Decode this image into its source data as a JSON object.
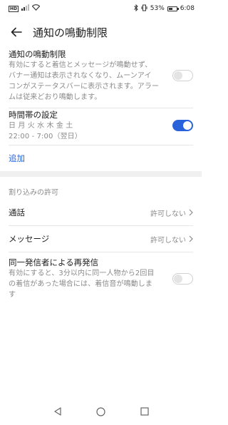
{
  "status_bar": {
    "hd": "HD",
    "battery_percent": "53%",
    "battery_level": 0.53,
    "time": "6:08"
  },
  "header": {
    "title": "通知の鳴動制限"
  },
  "dnd": {
    "title": "通知の鳴動制限",
    "description_lines": [
      "有効にすると着信とメッセージが鳴動せず、",
      "バナー通知は表示されなくなり、ムーンアイ",
      "コンがステータスバーに表示されます。アラー",
      "ムは従来どおり鳴動します。"
    ],
    "enabled": false
  },
  "schedule": {
    "title": "時間帯の設定",
    "days": "日 月 火 水 木 金 土",
    "time_range": "22:00 - 7:00（翌日）",
    "enabled": true
  },
  "add_label": "追加",
  "exceptions": {
    "header": "割り込みの許可",
    "calls": {
      "label": "通話",
      "value": "許可しない"
    },
    "messages": {
      "label": "メッセージ",
      "value": "許可しない"
    },
    "repeat_callers": {
      "title": "同一発信者による再発信",
      "description_lines": [
        "有効にすると、3分以内に同一人物から2回目",
        "の着信があった場合には、着信音が鳴動しま",
        "す"
      ],
      "enabled": false
    }
  },
  "colors": {
    "accent": "#2a63d9",
    "secondary_text": "#8a8a8a"
  }
}
